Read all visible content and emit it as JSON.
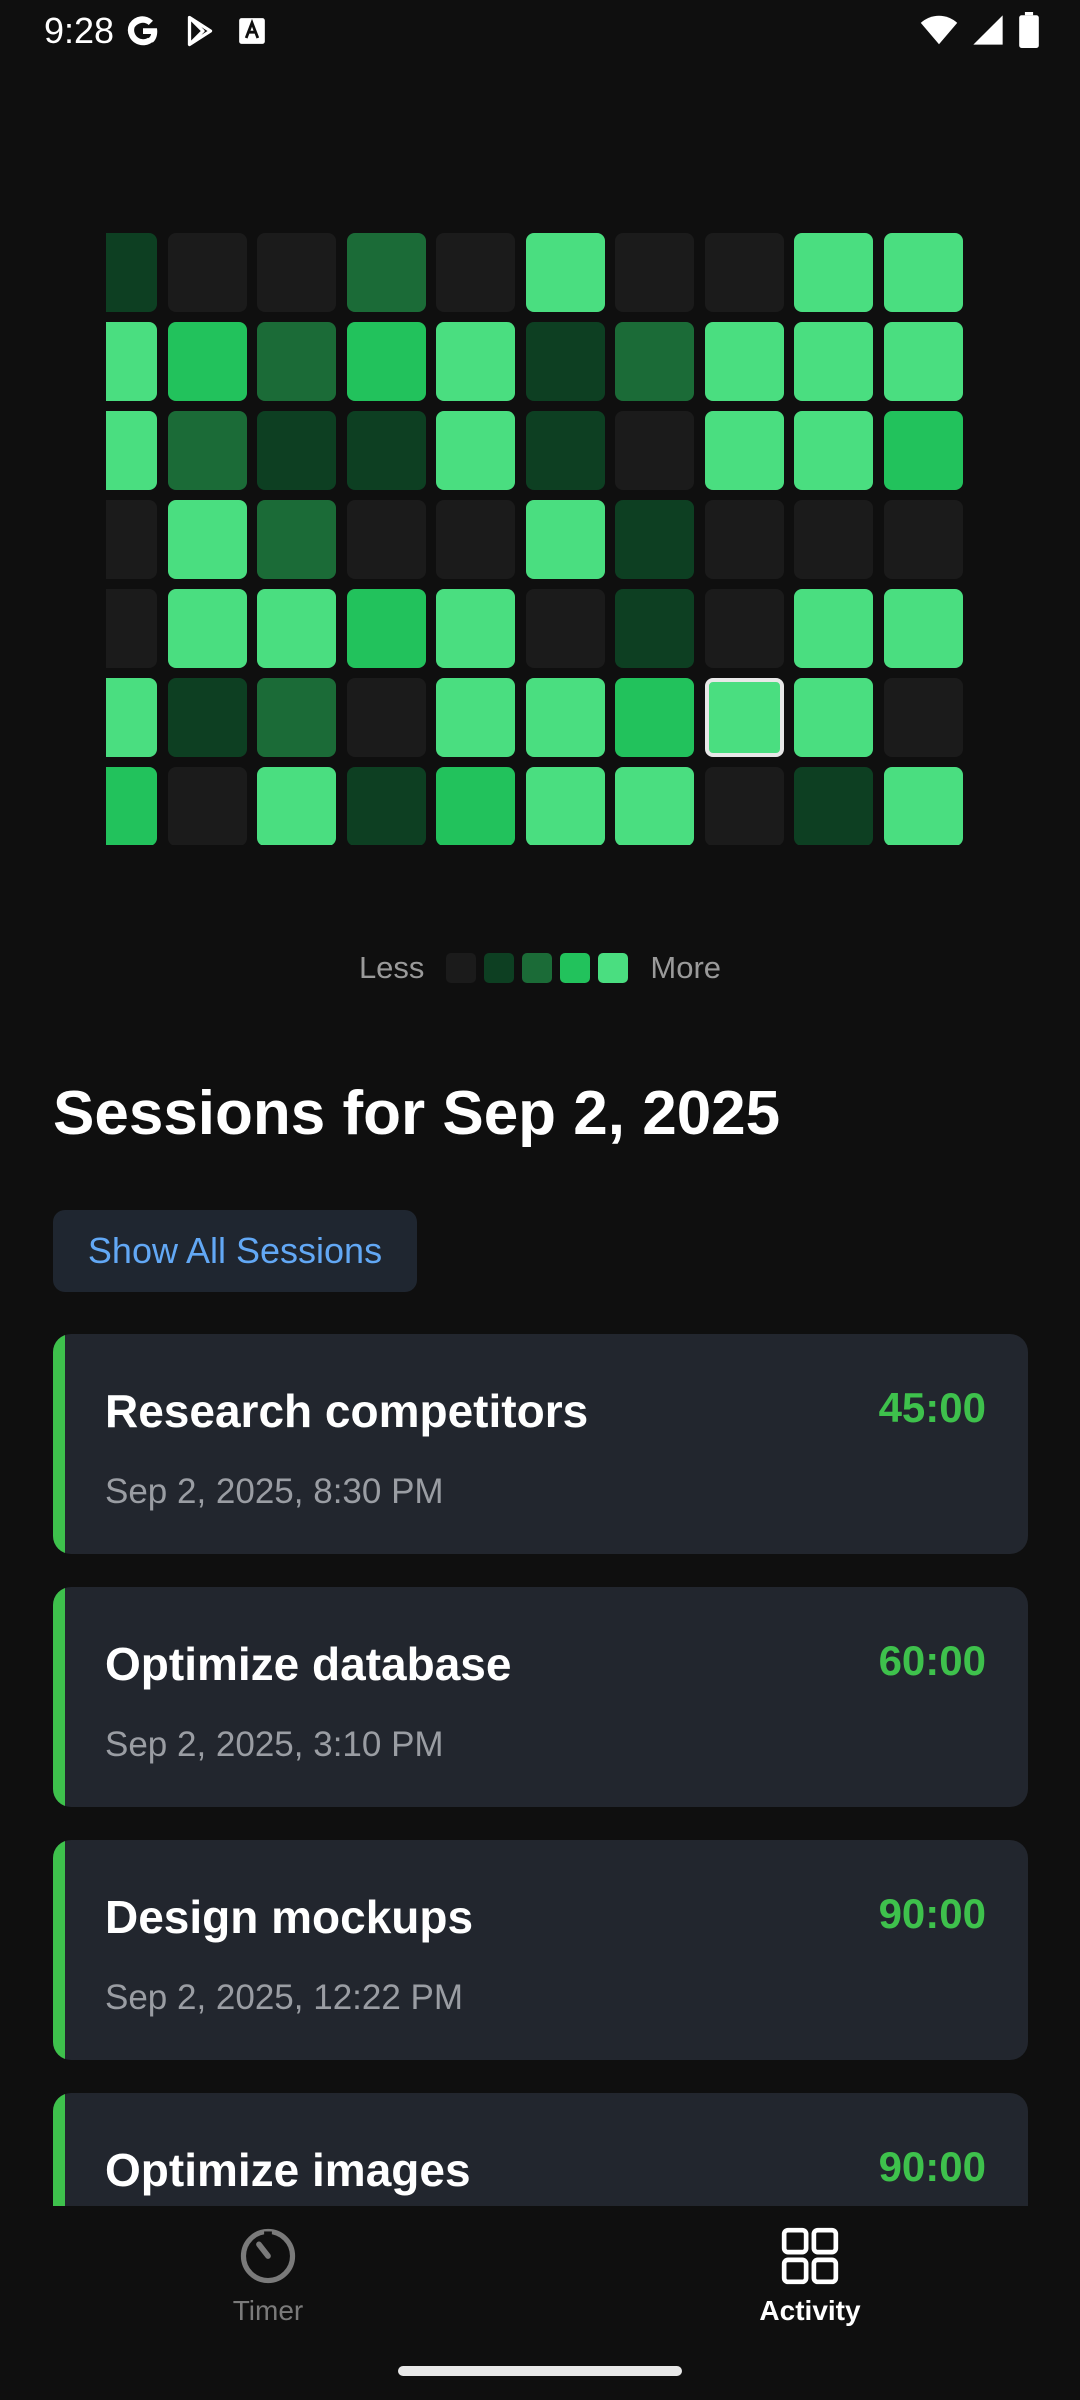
{
  "status_bar": {
    "time": "9:28",
    "left_icons": [
      "google-icon",
      "play-store-icon",
      "font-icon"
    ],
    "right_icons": [
      "wifi-icon",
      "signal-icon",
      "battery-icon"
    ]
  },
  "heatmap": {
    "colors": [
      "#1b1b1b",
      "#0d3f22",
      "#1b6b37",
      "#22c25c",
      "#4ade80"
    ],
    "levels": [
      [
        1,
        0,
        0,
        2,
        0,
        4,
        0,
        0,
        4,
        4
      ],
      [
        4,
        3,
        2,
        3,
        4,
        1,
        2,
        4,
        4,
        4
      ],
      [
        4,
        2,
        1,
        1,
        4,
        1,
        0,
        4,
        4,
        3
      ],
      [
        0,
        4,
        2,
        0,
        0,
        4,
        1,
        0,
        0,
        0
      ],
      [
        0,
        4,
        4,
        3,
        4,
        0,
        1,
        0,
        4,
        4
      ],
      [
        4,
        1,
        2,
        0,
        4,
        4,
        3,
        4,
        4,
        0
      ],
      [
        3,
        0,
        4,
        1,
        3,
        4,
        4,
        0,
        1,
        4
      ]
    ],
    "selected": {
      "row": 5,
      "col": 7
    }
  },
  "legend": {
    "less": "Less",
    "more": "More"
  },
  "sessions_title": "Sessions for Sep 2, 2025",
  "show_all_label": "Show All Sessions",
  "accent_color": "#3ec14c",
  "sessions": [
    {
      "name": "Research competitors",
      "datetime": "Sep 2, 2025, 8:30 PM",
      "duration": "45:00"
    },
    {
      "name": "Optimize database",
      "datetime": "Sep 2, 2025, 3:10 PM",
      "duration": "60:00"
    },
    {
      "name": "Design mockups",
      "datetime": "Sep 2, 2025, 12:22 PM",
      "duration": "90:00"
    },
    {
      "name": "Optimize images",
      "datetime": "",
      "duration": "90:00"
    }
  ],
  "nav": {
    "timer_label": "Timer",
    "timer_icon": "timer-icon",
    "activity_label": "Activity",
    "activity_icon": "grid-icon",
    "active": "activity"
  }
}
